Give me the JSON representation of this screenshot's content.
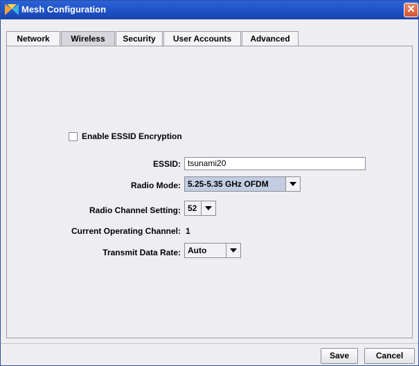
{
  "window": {
    "title": "Mesh Configuration",
    "close_glyph": "✕"
  },
  "tabs": [
    {
      "label": "Network",
      "active": false
    },
    {
      "label": "Wireless",
      "active": true
    },
    {
      "label": "Security",
      "active": false
    },
    {
      "label": "User Accounts",
      "active": false
    },
    {
      "label": "Advanced",
      "active": false
    }
  ],
  "form": {
    "encryption_label": "Enable ESSID Encryption",
    "encryption_checked": false,
    "essid_label": "ESSID:",
    "essid_value": "tsunami20",
    "radio_mode_label": "Radio Mode:",
    "radio_mode_value": "5.25-5.35 GHz OFDM",
    "channel_label": "Radio Channel Setting:",
    "channel_value": "52",
    "current_channel_label": "Current Operating Channel:",
    "current_channel_value": "1",
    "rate_label": "Transmit Data Rate:",
    "rate_value": "Auto"
  },
  "buttons": {
    "save": "Save",
    "cancel": "Cancel"
  },
  "icons": {
    "app": "mesh-app-icon",
    "close": "close-icon",
    "dropdown": "chevron-down-icon"
  },
  "colors": {
    "titlebar": "#1d50c4",
    "close": "#d3532e",
    "selected_combo": "#c3cde2"
  }
}
